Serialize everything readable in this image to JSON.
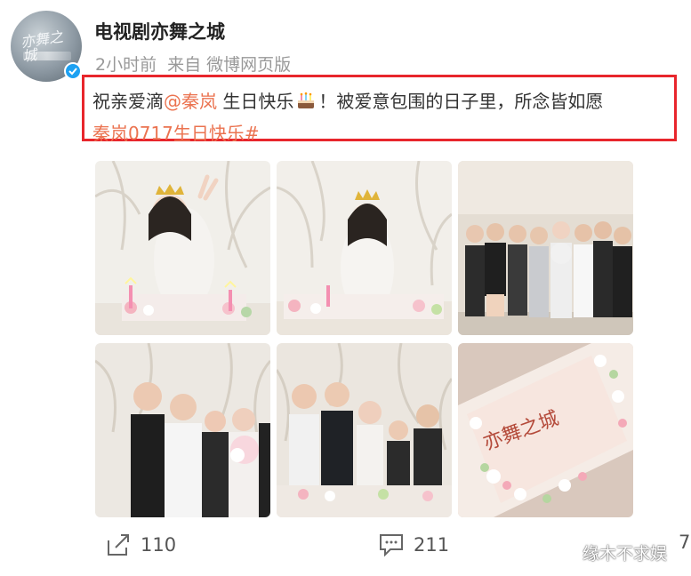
{
  "post": {
    "author": "电视剧亦舞之城",
    "time": "2小时前",
    "source": "来自 微博网页版",
    "text_before": "祝亲爱滴",
    "mention": "@秦岚",
    "text_after_mention": " 生日快乐",
    "text_after_emoji": "！被爱意包围的日子里，所念皆如愿",
    "hashtag": "秦岚0717生日快乐#",
    "avatar_logo": "亦舞之城",
    "verified_color": "#1da1f2",
    "highlight_color": "#e8262c",
    "link_color": "#eb7350"
  },
  "photos": [
    {
      "name": "photo-1-woman-crown-peace-sign"
    },
    {
      "name": "photo-2-woman-crown-hands-together"
    },
    {
      "name": "photo-3-group-photo"
    },
    {
      "name": "photo-4-group-with-flowers"
    },
    {
      "name": "photo-5-group-at-cake-table"
    },
    {
      "name": "photo-6-cake-closeup"
    }
  ],
  "actions": {
    "repost_icon": "share-icon",
    "repost_count": "110",
    "comment_icon": "comment-icon",
    "comment_count": "211",
    "like_count": "7"
  },
  "watermark": "缘木不求娱"
}
